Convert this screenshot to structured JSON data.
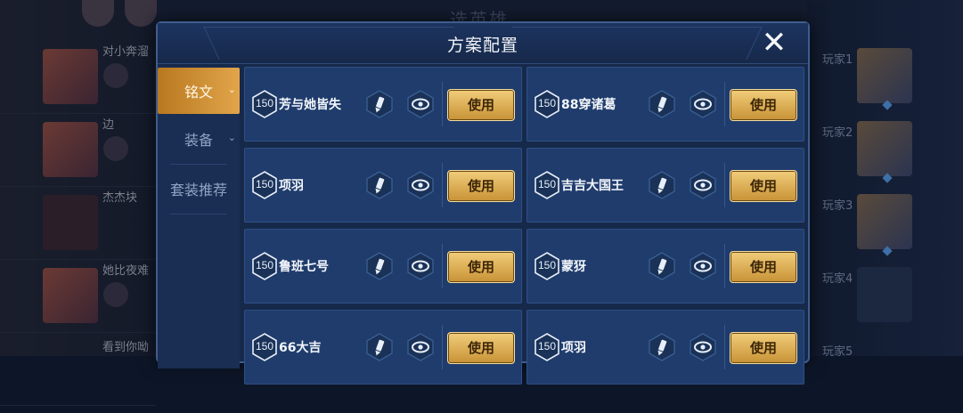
{
  "background": {
    "title": "选英雄",
    "left_players": [
      {
        "name": "对小奔溜"
      },
      {
        "name": "边"
      },
      {
        "name": "杰杰块"
      },
      {
        "name": "她比夜难"
      },
      {
        "name": "看到你呦"
      }
    ],
    "right_players": [
      {
        "name": "玩家1"
      },
      {
        "name": "玩家2"
      },
      {
        "name": "玩家3"
      },
      {
        "name": "玩家4"
      },
      {
        "name": "玩家5"
      }
    ]
  },
  "dialog": {
    "title": "方案配置",
    "close_icon": "close-icon"
  },
  "tabs": [
    {
      "label": "铭文",
      "active": true,
      "has_chevron": true
    },
    {
      "label": "装备",
      "active": false,
      "has_chevron": true
    },
    {
      "label": "套装推荐",
      "active": false,
      "has_chevron": false
    }
  ],
  "presets": [
    {
      "level": "150",
      "name": "芳与她皆失",
      "use_label": "使用"
    },
    {
      "level": "150",
      "name": "88穿诸葛",
      "use_label": "使用"
    },
    {
      "level": "150",
      "name": "项羽",
      "use_label": "使用"
    },
    {
      "level": "150",
      "name": "吉吉大国王",
      "use_label": "使用"
    },
    {
      "level": "150",
      "name": "鲁班七号",
      "use_label": "使用"
    },
    {
      "level": "150",
      "name": "蒙犽",
      "use_label": "使用"
    },
    {
      "level": "150",
      "name": "66大吉",
      "use_label": "使用"
    },
    {
      "level": "150",
      "name": "项羽",
      "use_label": "使用"
    }
  ],
  "colors": {
    "accent_gold": "#e2a54a",
    "panel_blue": "#1f3c6c",
    "dialog_bg": "#17294a"
  }
}
